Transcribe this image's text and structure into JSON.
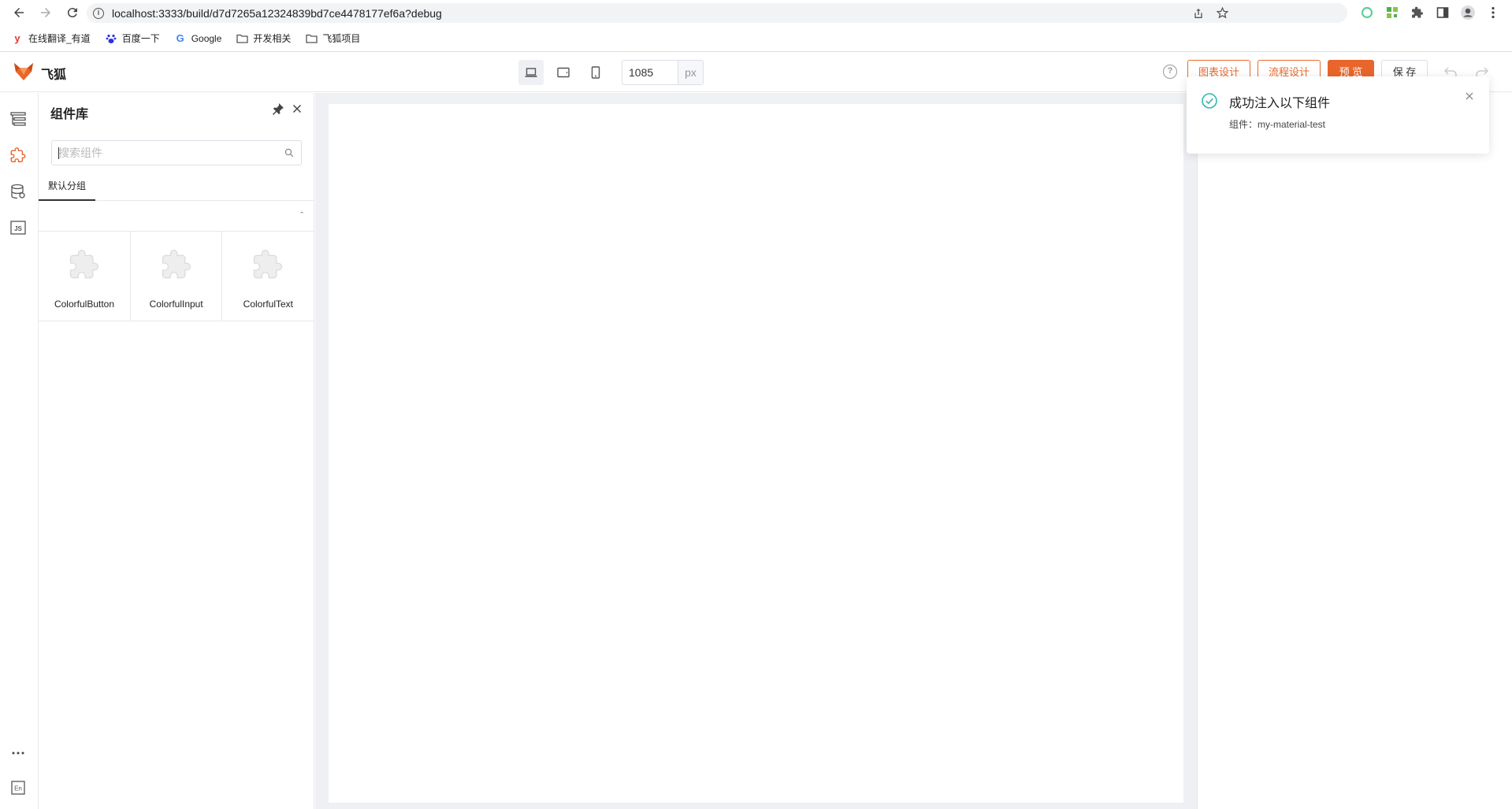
{
  "browser": {
    "url": "localhost:3333/build/d7d7265a12324839bd7ce4478177ef6a?debug",
    "bookmarks": [
      {
        "label": "在线翻译_有道",
        "icon": "youdao-icon"
      },
      {
        "label": "百度一下",
        "icon": "baidu-icon"
      },
      {
        "label": "Google",
        "icon": "google-icon"
      },
      {
        "label": "开发相关",
        "icon": "folder-icon"
      },
      {
        "label": "飞狐项目",
        "icon": "folder-icon"
      }
    ]
  },
  "header": {
    "brand": "飞狐",
    "width_value": "1085",
    "width_unit": "px",
    "buttons": {
      "chart_design": "图表设计",
      "flow_design": "流程设计",
      "preview": "预 览",
      "save": "保 存"
    }
  },
  "panel": {
    "title": "组件库",
    "search_placeholder": "搜索组件",
    "tab": "默认分组",
    "components": [
      "ColorfulButton",
      "ColorfulInput",
      "ColorfulText"
    ]
  },
  "notification": {
    "title": "成功注入以下组件",
    "body": "组件：my-material-test"
  },
  "colors": {
    "accent": "#e8662c",
    "success": "#2fb8ac",
    "canvas_bg": "#eff0f3"
  }
}
